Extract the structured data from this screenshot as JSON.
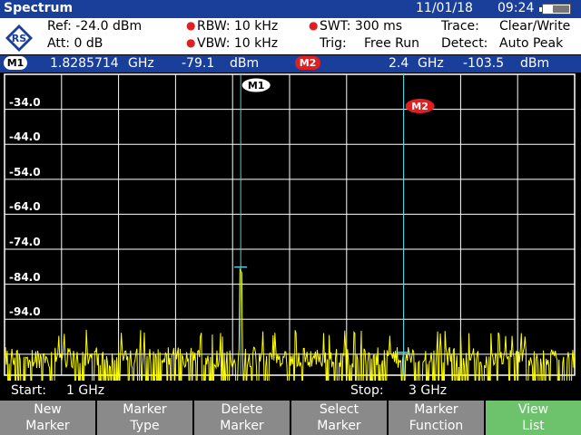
{
  "header": {
    "title": "Spectrum",
    "date": "11/01/18",
    "time": "09:24"
  },
  "settings": {
    "ref": "Ref:  -24.0 dBm",
    "att": "Att:  0 dB",
    "rbw": "RBW:   10 kHz",
    "vbw": "VBW:   10 kHz",
    "swt": "SWT:   300 ms",
    "trig_label": "Trig:",
    "trig_value": "Free Run",
    "trace_label": "Trace:",
    "trace_value": "Clear/Write",
    "detect_label": "Detect:",
    "detect_value": "Auto Peak"
  },
  "markers": {
    "m1_label": "M1",
    "m1_freq": "1.8285714",
    "m1_freq_unit": "GHz",
    "m1_level": "-79.1",
    "m1_level_unit": "dBm",
    "m2_label": "M2",
    "m2_freq": "2.4",
    "m2_freq_unit": "GHz",
    "m2_level": "-103.5",
    "m2_level_unit": "dBm"
  },
  "chart_data": {
    "type": "line",
    "title": "",
    "xlabel": "",
    "ylabel": "",
    "xlim": [
      1,
      3
    ],
    "x_unit": "GHz",
    "ylim": [
      -110,
      -24
    ],
    "y_unit": "dBm",
    "yticks": [
      "-34.0",
      "-44.0",
      "-54.0",
      "-64.0",
      "-74.0",
      "-84.0",
      "-94.0"
    ],
    "grid": true,
    "series": [
      {
        "color": "#ffff00",
        "noise_floor_dBm": -104,
        "noise_peak_dBm": -99
      }
    ],
    "markers": [
      {
        "label": "M1",
        "x": 1.8285714,
        "y": -79.1
      },
      {
        "label": "M2",
        "x": 2.4,
        "y": -103.5
      }
    ]
  },
  "footer": {
    "start_label": "Start:",
    "start_value": "1 GHz",
    "stop_label": "Stop:",
    "stop_value": "3 GHz"
  },
  "softkeys": [
    {
      "line1": "New",
      "line2": "Marker"
    },
    {
      "line1": "Marker",
      "line2": "Type"
    },
    {
      "line1": "Delete",
      "line2": "Marker"
    },
    {
      "line1": "Select",
      "line2": "Marker"
    },
    {
      "line1": "Marker",
      "line2": "Function"
    },
    {
      "line1": "View",
      "line2": "List"
    }
  ],
  "colors": {
    "header_bg": "#1a3f9a",
    "trace": "#ffff00",
    "marker_line": "#5ec8d8",
    "marker_badge": "#e02020",
    "softkey_bg": "#8a8a8a",
    "softkey_active": "#6cc36c"
  }
}
